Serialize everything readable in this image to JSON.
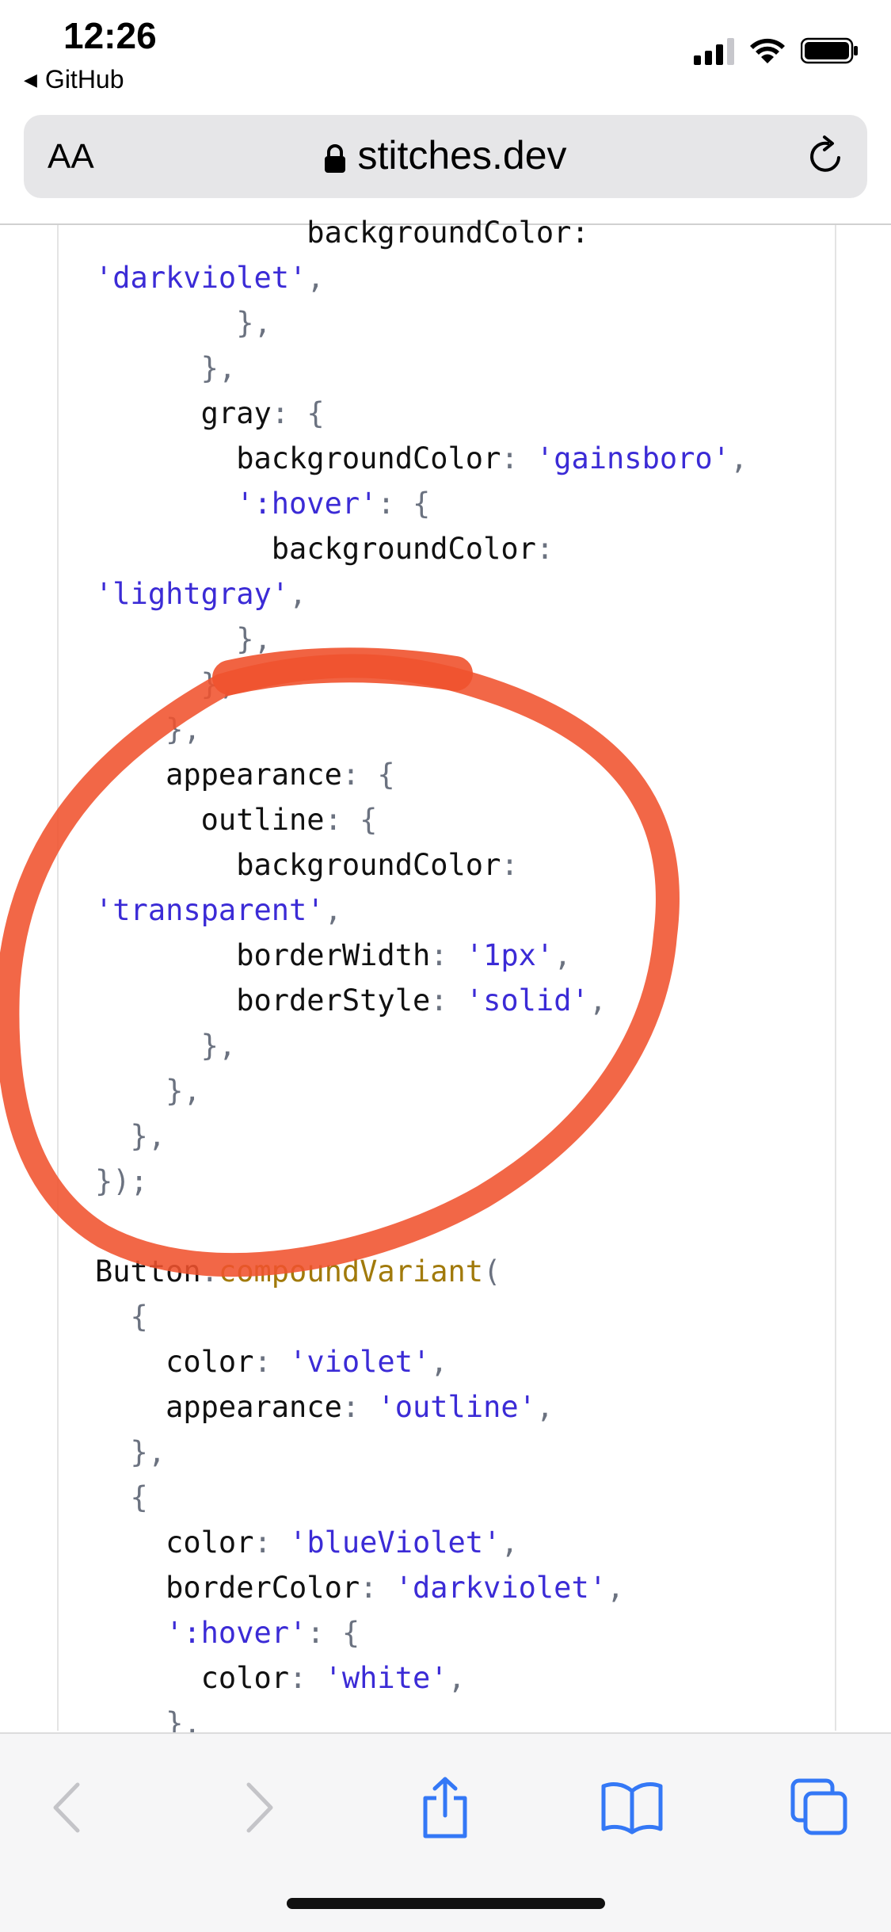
{
  "status_bar": {
    "time": "12:26",
    "back_app": "GitHub"
  },
  "url_bar": {
    "text_size_label": "AA",
    "domain": "stitches.dev"
  },
  "code_lines": [
    [
      [
        "k",
        "            backgroundColor:"
      ]
    ],
    [
      [
        "s",
        "'darkviolet'"
      ],
      [
        "p",
        ","
      ]
    ],
    [
      [
        "p",
        "        },"
      ]
    ],
    [
      [
        "p",
        "      },"
      ]
    ],
    [
      [
        "k",
        "      gray"
      ],
      [
        "p",
        ": {"
      ]
    ],
    [
      [
        "k",
        "        backgroundColor"
      ],
      [
        "p",
        ": "
      ],
      [
        "s",
        "'gainsboro'"
      ],
      [
        "p",
        ","
      ]
    ],
    [
      [
        "s",
        "        ':hover'"
      ],
      [
        "p",
        ": {"
      ]
    ],
    [
      [
        "k",
        "          backgroundColor"
      ],
      [
        "p",
        ":"
      ]
    ],
    [
      [
        "s",
        "'lightgray'"
      ],
      [
        "p",
        ","
      ]
    ],
    [
      [
        "p",
        "        },"
      ]
    ],
    [
      [
        "p",
        "      },"
      ]
    ],
    [
      [
        "p",
        "    },"
      ]
    ],
    [
      [
        "k",
        "    appearance"
      ],
      [
        "p",
        ": {"
      ]
    ],
    [
      [
        "k",
        "      outline"
      ],
      [
        "p",
        ": {"
      ]
    ],
    [
      [
        "k",
        "        backgroundColor"
      ],
      [
        "p",
        ":"
      ]
    ],
    [
      [
        "s",
        "'transparent'"
      ],
      [
        "p",
        ","
      ]
    ],
    [
      [
        "k",
        "        borderWidth"
      ],
      [
        "p",
        ": "
      ],
      [
        "s",
        "'1px'"
      ],
      [
        "p",
        ","
      ]
    ],
    [
      [
        "k",
        "        borderStyle"
      ],
      [
        "p",
        ": "
      ],
      [
        "s",
        "'solid'"
      ],
      [
        "p",
        ","
      ]
    ],
    [
      [
        "p",
        "      },"
      ]
    ],
    [
      [
        "p",
        "    },"
      ]
    ],
    [
      [
        "p",
        "  },"
      ]
    ],
    [
      [
        "p",
        "});"
      ]
    ],
    [],
    [
      [
        "k",
        "Button"
      ],
      [
        "p",
        "."
      ],
      [
        "f",
        "compoundVariant"
      ],
      [
        "p",
        "("
      ]
    ],
    [
      [
        "p",
        "  {"
      ]
    ],
    [
      [
        "k",
        "    color"
      ],
      [
        "p",
        ": "
      ],
      [
        "s",
        "'violet'"
      ],
      [
        "p",
        ","
      ]
    ],
    [
      [
        "k",
        "    appearance"
      ],
      [
        "p",
        ": "
      ],
      [
        "s",
        "'outline'"
      ],
      [
        "p",
        ","
      ]
    ],
    [
      [
        "p",
        "  },"
      ]
    ],
    [
      [
        "p",
        "  {"
      ]
    ],
    [
      [
        "k",
        "    color"
      ],
      [
        "p",
        ": "
      ],
      [
        "s",
        "'blueViolet'"
      ],
      [
        "p",
        ","
      ]
    ],
    [
      [
        "k",
        "    borderColor"
      ],
      [
        "p",
        ": "
      ],
      [
        "s",
        "'darkviolet'"
      ],
      [
        "p",
        ","
      ]
    ],
    [
      [
        "s",
        "    ':hover'"
      ],
      [
        "p",
        ": {"
      ]
    ],
    [
      [
        "k",
        "      color"
      ],
      [
        "p",
        ": "
      ],
      [
        "s",
        "'white'"
      ],
      [
        "p",
        ","
      ]
    ],
    [
      [
        "p",
        "    },"
      ]
    ]
  ],
  "colors": {
    "accent": "#3478f6",
    "annotation": "#f0522d",
    "string": "#3b2bd6",
    "punctuation": "#6b7280",
    "function": "#a17a0b"
  },
  "icons": {
    "back": "chevron-left-icon",
    "forward": "chevron-right-icon",
    "share": "share-icon",
    "bookmarks": "book-icon",
    "tabs": "tabs-icon",
    "lock": "lock-icon",
    "reload": "reload-icon"
  }
}
